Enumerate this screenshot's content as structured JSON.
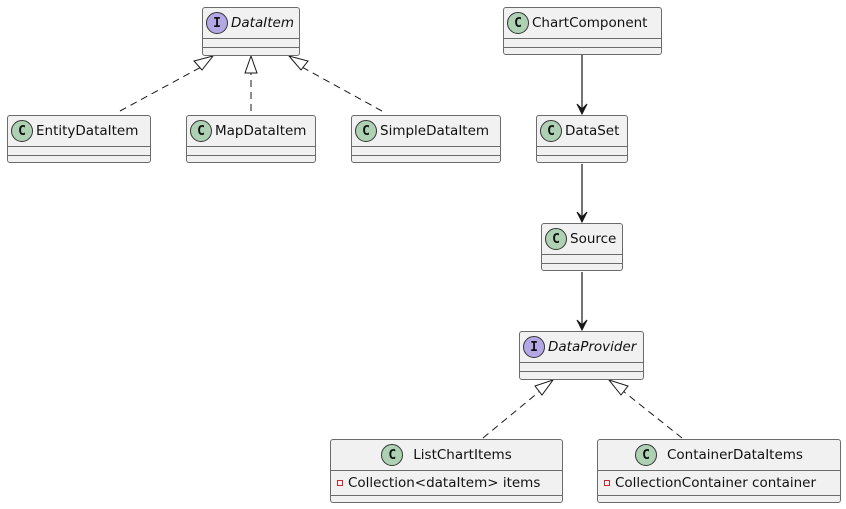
{
  "diagram": {
    "type": "uml-class-diagram",
    "classes": [
      {
        "id": "DataItem",
        "name": "DataItem",
        "kind": "interface",
        "stereotype_letter": "I",
        "fields": []
      },
      {
        "id": "EntityDataItem",
        "name": "EntityDataItem",
        "kind": "class",
        "stereotype_letter": "C",
        "fields": []
      },
      {
        "id": "MapDataItem",
        "name": "MapDataItem",
        "kind": "class",
        "stereotype_letter": "C",
        "fields": []
      },
      {
        "id": "SimpleDataItem",
        "name": "SimpleDataItem",
        "kind": "class",
        "stereotype_letter": "C",
        "fields": []
      },
      {
        "id": "ChartComponent",
        "name": "ChartComponent",
        "kind": "class",
        "stereotype_letter": "C",
        "fields": []
      },
      {
        "id": "DataSet",
        "name": "DataSet",
        "kind": "class",
        "stereotype_letter": "C",
        "fields": []
      },
      {
        "id": "Source",
        "name": "Source",
        "kind": "class",
        "stereotype_letter": "C",
        "fields": []
      },
      {
        "id": "DataProvider",
        "name": "DataProvider",
        "kind": "interface",
        "stereotype_letter": "I",
        "fields": []
      },
      {
        "id": "ListChartItems",
        "name": "ListChartItems",
        "kind": "class",
        "stereotype_letter": "C",
        "fields": [
          {
            "visibility": "private",
            "text": "Collection<dataItem> items"
          }
        ]
      },
      {
        "id": "ContainerDataItems",
        "name": "ContainerDataItems",
        "kind": "class",
        "stereotype_letter": "C",
        "fields": [
          {
            "visibility": "private",
            "text": "CollectionContainer container"
          }
        ]
      }
    ],
    "relations": [
      {
        "from": "EntityDataItem",
        "to": "DataItem",
        "type": "realization"
      },
      {
        "from": "MapDataItem",
        "to": "DataItem",
        "type": "realization"
      },
      {
        "from": "SimpleDataItem",
        "to": "DataItem",
        "type": "realization"
      },
      {
        "from": "ChartComponent",
        "to": "DataSet",
        "type": "association"
      },
      {
        "from": "DataSet",
        "to": "Source",
        "type": "association"
      },
      {
        "from": "Source",
        "to": "DataProvider",
        "type": "association"
      },
      {
        "from": "ListChartItems",
        "to": "DataProvider",
        "type": "realization"
      },
      {
        "from": "ContainerDataItems",
        "to": "DataProvider",
        "type": "realization"
      }
    ],
    "colors": {
      "class_badge": "#add1b2",
      "interface_badge": "#b4a7e5",
      "box_fill": "#f1f1f1",
      "border": "#6b6b6b",
      "private_marker": "#c82930"
    }
  }
}
